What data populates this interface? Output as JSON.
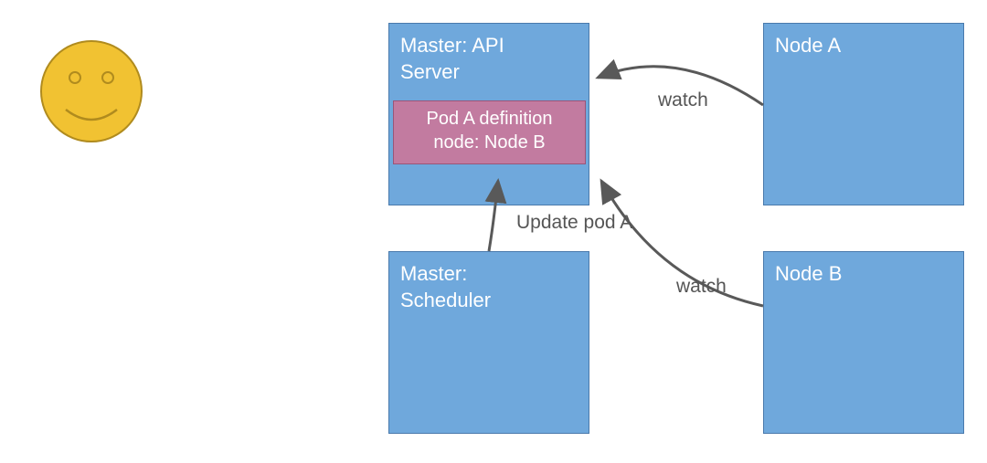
{
  "boxes": {
    "api_server": {
      "line1": "Master: API",
      "line2": "Server"
    },
    "scheduler": {
      "line1": "Master:",
      "line2": "Scheduler"
    },
    "node_a": {
      "label": "Node A"
    },
    "node_b": {
      "label": "Node B"
    }
  },
  "pod": {
    "line1": "Pod A definition",
    "line2": "node: Node B"
  },
  "arrows": {
    "watch_a": "watch",
    "watch_b": "watch",
    "update": "Update pod A"
  },
  "colors": {
    "box_fill": "#6fa8dc",
    "box_stroke": "#4a7aac",
    "pod_fill": "#c27ba0",
    "pod_stroke": "#9a5578",
    "arrow": "#595959",
    "smiley_fill": "#f1c232",
    "smiley_stroke": "#b08b1e"
  }
}
